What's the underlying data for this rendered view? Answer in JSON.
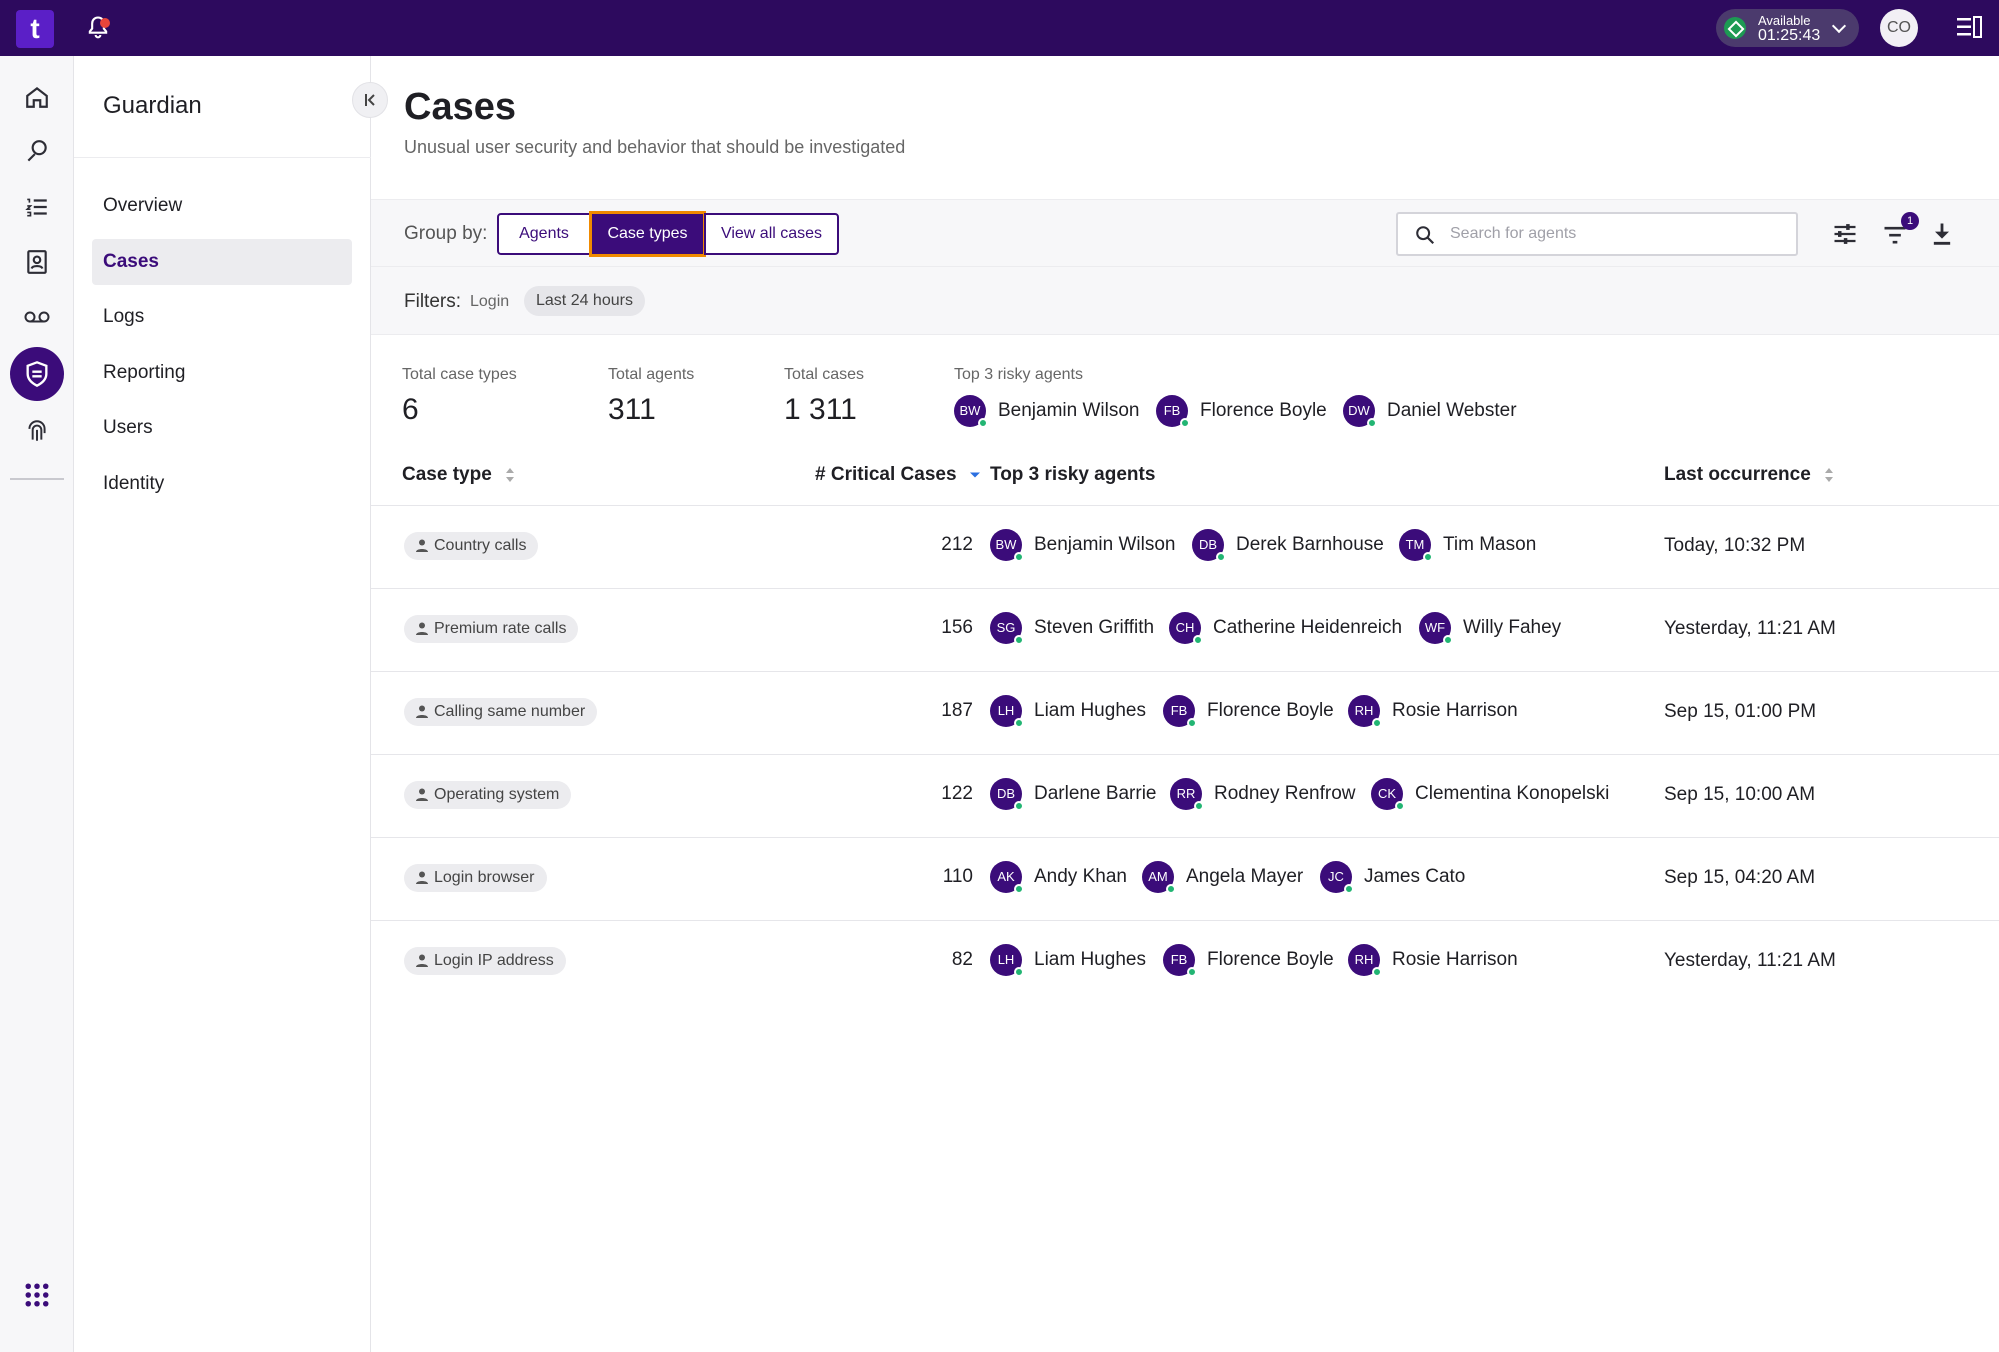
{
  "topbar": {
    "logo_text": "t",
    "status_label": "Available",
    "status_time": "01:25:43",
    "user_initials": "CO"
  },
  "nav": {
    "title": "Guardian",
    "items": [
      {
        "label": "Overview"
      },
      {
        "label": "Cases"
      },
      {
        "label": "Logs"
      },
      {
        "label": "Reporting"
      },
      {
        "label": "Users"
      },
      {
        "label": "Identity"
      }
    ],
    "active": "Cases"
  },
  "page": {
    "title": "Cases",
    "subtitle": "Unusual user security and behavior that should be investigated"
  },
  "toolbar": {
    "group_by_label": "Group by:",
    "segments": [
      "Agents",
      "Case types",
      "View all cases"
    ],
    "active_segment": "Case types",
    "search_placeholder": "Search for agents",
    "filter_badge": "1"
  },
  "filters": {
    "label": "Filters:",
    "plain": "Login",
    "chip": "Last 24 hours"
  },
  "summary": {
    "total_case_types_label": "Total case types",
    "total_case_types": "6",
    "total_agents_label": "Total agents",
    "total_agents": "311",
    "total_cases_label": "Total cases",
    "total_cases": "1 311",
    "top_risky_label": "Top 3 risky agents",
    "top_risky": [
      {
        "initials": "BW",
        "name": "Benjamin Wilson"
      },
      {
        "initials": "FB",
        "name": "Florence Boyle"
      },
      {
        "initials": "DW",
        "name": "Daniel Webster"
      }
    ]
  },
  "table": {
    "headers": {
      "case_type": "Case type",
      "critical": "# Critical Cases",
      "risky": "Top 3 risky agents",
      "last": "Last occurrence"
    },
    "rows": [
      {
        "case_type": "Country calls",
        "critical": "212",
        "agents": [
          {
            "initials": "BW",
            "name": "Benjamin Wilson"
          },
          {
            "initials": "DB",
            "name": "Derek Barnhouse"
          },
          {
            "initials": "TM",
            "name": "Tim Mason"
          }
        ],
        "last": "Today, 10:32 PM"
      },
      {
        "case_type": "Premium rate calls",
        "critical": "156",
        "agents": [
          {
            "initials": "SG",
            "name": "Steven Griffith"
          },
          {
            "initials": "CH",
            "name": "Catherine Heidenreich"
          },
          {
            "initials": "WF",
            "name": "Willy Fahey"
          }
        ],
        "last": "Yesterday, 11:21 AM"
      },
      {
        "case_type": "Calling same number",
        "critical": "187",
        "agents": [
          {
            "initials": "LH",
            "name": "Liam Hughes"
          },
          {
            "initials": "FB",
            "name": "Florence Boyle"
          },
          {
            "initials": "RH",
            "name": "Rosie Harrison"
          }
        ],
        "last": "Sep 15, 01:00 PM"
      },
      {
        "case_type": "Operating system",
        "critical": "122",
        "agents": [
          {
            "initials": "DB",
            "name": "Darlene Barrie"
          },
          {
            "initials": "RR",
            "name": "Rodney Renfrow"
          },
          {
            "initials": "CK",
            "name": "Clementina Konopelski"
          }
        ],
        "last": "Sep 15, 10:00 AM"
      },
      {
        "case_type": "Login browser",
        "critical": "110",
        "agents": [
          {
            "initials": "AK",
            "name": "Andy Khan"
          },
          {
            "initials": "AM",
            "name": "Angela Mayer"
          },
          {
            "initials": "JC",
            "name": "James Cato"
          }
        ],
        "last": "Sep 15, 04:20 AM"
      },
      {
        "case_type": "Login IP address",
        "critical": "82",
        "agents": [
          {
            "initials": "LH",
            "name": "Liam Hughes"
          },
          {
            "initials": "FB",
            "name": "Florence Boyle"
          },
          {
            "initials": "RH",
            "name": "Rosie Harrison"
          }
        ],
        "last": "Yesterday, 11:21 AM"
      }
    ]
  },
  "colors": {
    "brand": "#2d0a5e",
    "accent": "#3b0c7a",
    "focus": "#f08a00",
    "online": "#22b573"
  }
}
